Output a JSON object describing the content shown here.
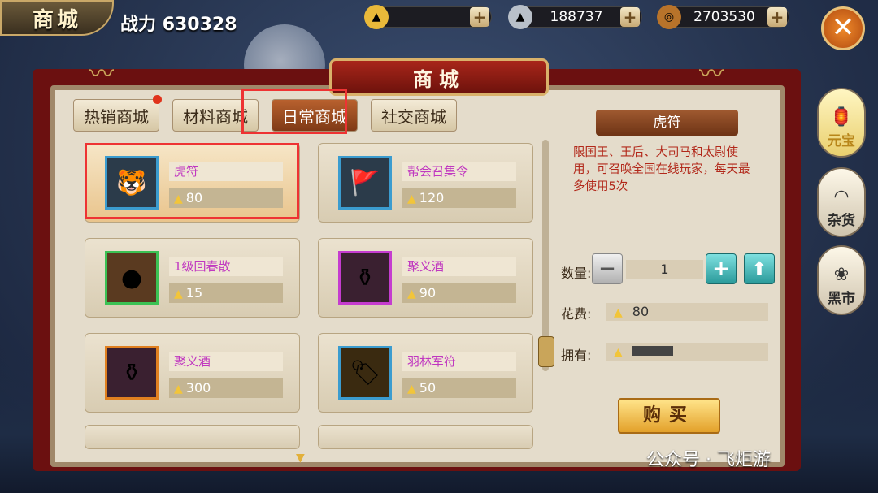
{
  "header": {
    "badge_title": "商城",
    "combat_label": "战力",
    "combat_value": "630328"
  },
  "currencies": [
    {
      "icon": "gold-ingot-icon",
      "value": ""
    },
    {
      "icon": "silver-ingot-icon",
      "value": "188737"
    },
    {
      "icon": "copper-coin-icon",
      "value": "2703530"
    }
  ],
  "panel_title": "商城",
  "tabs": [
    {
      "label": "热销商城",
      "badge": true
    },
    {
      "label": "材料商城",
      "badge": false
    },
    {
      "label": "日常商城",
      "active": true
    },
    {
      "label": "社交商城",
      "badge": false
    }
  ],
  "items": [
    {
      "name": "虎符",
      "price": "80"
    },
    {
      "name": "帮会召集令",
      "price": "120"
    },
    {
      "name": "1级回春散",
      "price": "15"
    },
    {
      "name": "聚义酒",
      "price": "90"
    },
    {
      "name": "聚义酒",
      "price": "300"
    },
    {
      "name": "羽林军符",
      "price": "50"
    }
  ],
  "detail": {
    "title": "虎符",
    "description": "限国王、王后、大司马和太尉使用，可召唤全国在线玩家，每天最多使用5次",
    "qty_label": "数量:",
    "qty": "1",
    "cost_label": "花费:",
    "cost": "80",
    "own_label": "拥有:",
    "own": "",
    "buy_label": "购买"
  },
  "side_nav": [
    {
      "label": "元宝",
      "active": true
    },
    {
      "label": "杂货",
      "active": false
    },
    {
      "label": "黑市",
      "active": false
    }
  ],
  "watermark": "公众号 · 飞炬游",
  "colors": {
    "accent_red": "#e33333",
    "item_name": "#c038c0",
    "desc_text": "#b2281a"
  }
}
